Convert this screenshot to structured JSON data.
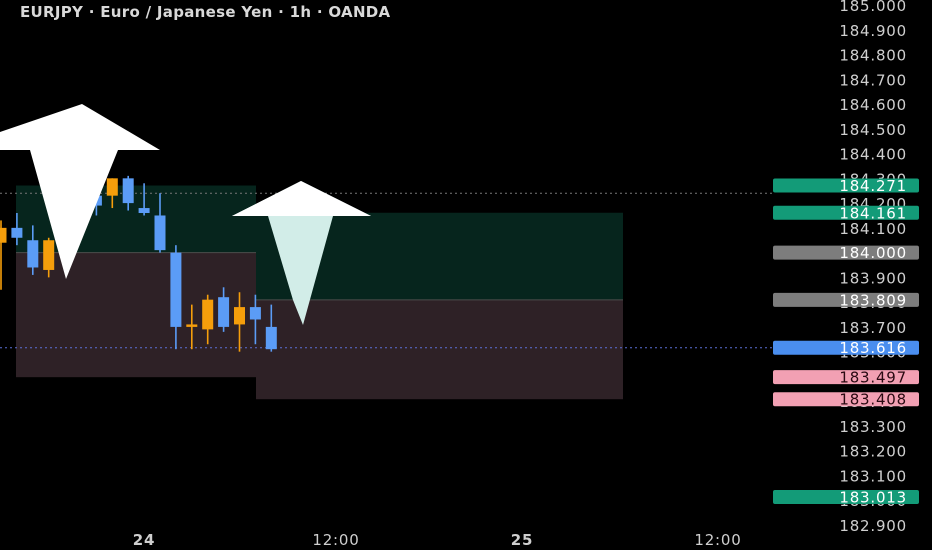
{
  "header": {
    "title": "EURJPY · Euro / Japanese Yen · 1h · OANDA"
  },
  "colors": {
    "background": "#000000",
    "bull": "#f59e0b",
    "bear": "#5b9cf6",
    "target_zone": "#06251d",
    "stop_zone": "#2e2126",
    "label_green": "#139b78",
    "label_gray": "#7d7d7d",
    "label_blue": "#4a8eef",
    "label_pink": "#f2a0b3",
    "arrow_white": "#ffffff",
    "arrow_pale": "#d2ede8"
  },
  "chart_data": {
    "type": "candlestick",
    "symbol": "EURJPY",
    "timeframe": "1h",
    "ylim": [
      182.9,
      185.0
    ],
    "y_ticks": [
      "185.000",
      "184.900",
      "184.800",
      "184.700",
      "184.600",
      "184.500",
      "184.400",
      "184.300",
      "184.200",
      "184.100",
      "184.000",
      "183.900",
      "183.800",
      "183.700",
      "183.600",
      "183.500",
      "183.400",
      "183.300",
      "183.200",
      "183.100",
      "183.000",
      "182.900"
    ],
    "x_ticks": [
      "24",
      "12:00",
      "25",
      "12:00"
    ],
    "candles": [
      {
        "o": 184.04,
        "h": 184.13,
        "l": 183.85,
        "c": 184.1
      },
      {
        "o": 184.1,
        "h": 184.16,
        "l": 184.03,
        "c": 184.06
      },
      {
        "o": 184.05,
        "h": 184.11,
        "l": 183.91,
        "c": 183.94
      },
      {
        "o": 183.93,
        "h": 184.06,
        "l": 183.9,
        "c": 184.05
      },
      {
        "o": 184.04,
        "h": 184.14,
        "l": 184.01,
        "c": 184.12
      },
      {
        "o": 184.11,
        "h": 184.27,
        "l": 184.09,
        "c": 184.24
      },
      {
        "o": 184.23,
        "h": 184.29,
        "l": 184.15,
        "c": 184.19
      },
      {
        "o": 184.23,
        "h": 184.3,
        "l": 184.18,
        "c": 184.3
      },
      {
        "o": 184.3,
        "h": 184.31,
        "l": 184.17,
        "c": 184.2
      },
      {
        "o": 184.18,
        "h": 184.28,
        "l": 184.15,
        "c": 184.16
      },
      {
        "o": 184.15,
        "h": 184.24,
        "l": 184.0,
        "c": 184.01
      },
      {
        "o": 184.0,
        "h": 184.03,
        "l": 183.61,
        "c": 183.7
      },
      {
        "o": 183.7,
        "h": 183.79,
        "l": 183.61,
        "c": 183.71
      },
      {
        "o": 183.69,
        "h": 183.83,
        "l": 183.63,
        "c": 183.81
      },
      {
        "o": 183.82,
        "h": 183.86,
        "l": 183.68,
        "c": 183.7
      },
      {
        "o": 183.71,
        "h": 183.84,
        "l": 183.6,
        "c": 183.78
      },
      {
        "o": 183.78,
        "h": 183.83,
        "l": 183.63,
        "c": 183.73
      },
      {
        "o": 183.7,
        "h": 183.79,
        "l": 183.6,
        "c": 183.61
      }
    ],
    "price_labels": [
      {
        "value": "184.271",
        "color": "label_green",
        "text": "#ffffff"
      },
      {
        "value": "184.161",
        "color": "label_green",
        "text": "#ffffff"
      },
      {
        "value": "184.000",
        "color": "label_gray",
        "text": "#ffffff"
      },
      {
        "value": "183.809",
        "color": "label_gray",
        "text": "#ffffff"
      },
      {
        "value": "183.616",
        "color": "label_blue",
        "text": "#ffffff"
      },
      {
        "value": "183.497",
        "color": "label_pink",
        "text": "#2a0a12"
      },
      {
        "value": "183.408",
        "color": "label_pink",
        "text": "#2a0a12"
      },
      {
        "value": "183.013",
        "color": "label_green",
        "text": "#ffffff"
      }
    ],
    "dotted_lines": [
      184.24,
      183.616
    ],
    "zones": [
      {
        "kind": "target",
        "from": 184.0,
        "to": 184.271
      },
      {
        "kind": "stop",
        "from": 183.497,
        "to": 184.0
      },
      {
        "kind": "target",
        "from": 183.809,
        "to": 184.161
      },
      {
        "kind": "stop",
        "from": 183.408,
        "to": 183.809
      }
    ],
    "arrows": [
      {
        "direction": "up",
        "color": "arrow_white"
      },
      {
        "direction": "down",
        "color": "arrow_pale"
      }
    ]
  }
}
